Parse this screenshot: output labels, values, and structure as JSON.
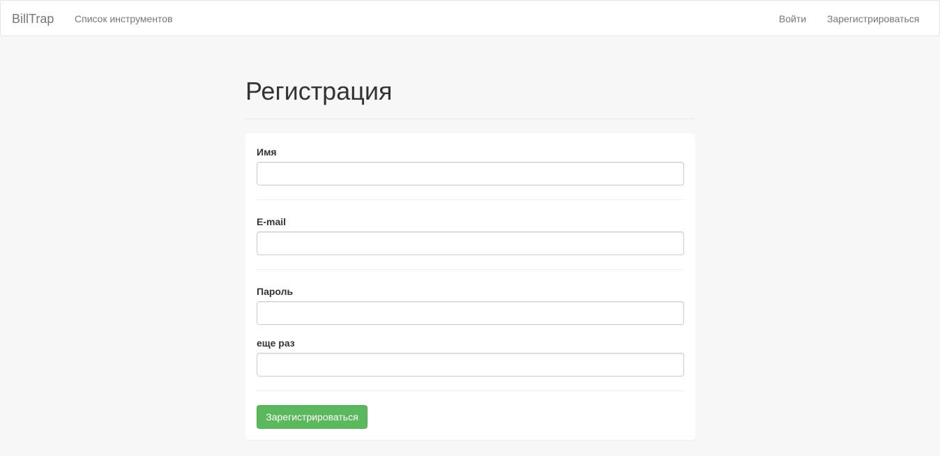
{
  "navbar": {
    "brand": "BillTrap",
    "tools_link": "Список инструментов",
    "login_link": "Войти",
    "register_link": "Зарегистрироваться"
  },
  "page": {
    "title": "Регистрация"
  },
  "form": {
    "name_label": "Имя",
    "name_value": "",
    "email_label": "E-mail",
    "email_value": "",
    "password_label": "Пароль",
    "password_value": "",
    "password_repeat_label": "еще раз",
    "password_repeat_value": "",
    "submit_label": "Зарегистрироваться"
  },
  "colors": {
    "background": "#f7f7f7",
    "submit_button": "#5cb85c"
  }
}
